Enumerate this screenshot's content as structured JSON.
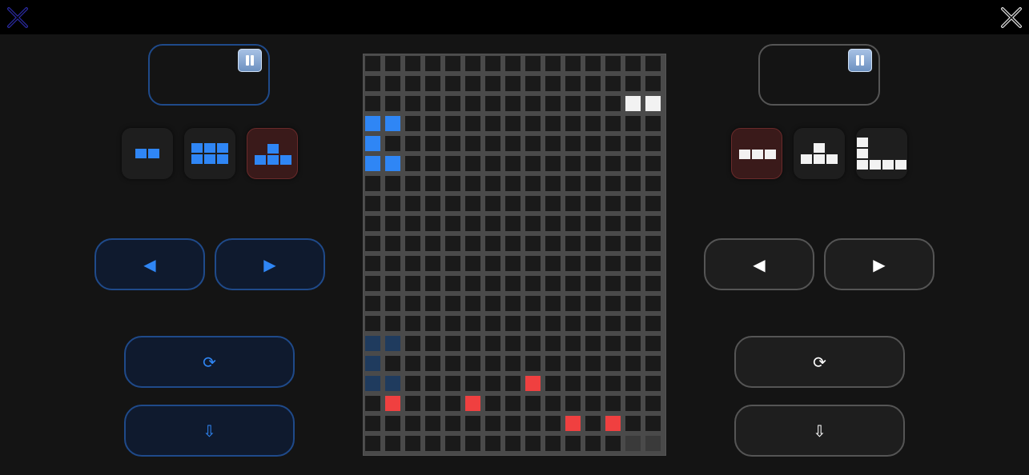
{
  "players": {
    "left": {
      "score": "",
      "color": "#2f86f5",
      "pieces": [
        {
          "name": "domino",
          "cells": [
            [
              0,
              0
            ],
            [
              1,
              0
            ]
          ],
          "selected": false
        },
        {
          "name": "rect-3x2",
          "cells": [
            [
              0,
              0
            ],
            [
              1,
              0
            ],
            [
              2,
              0
            ],
            [
              0,
              1
            ],
            [
              1,
              1
            ],
            [
              2,
              1
            ]
          ],
          "selected": false
        },
        {
          "name": "t-piece",
          "cells": [
            [
              1,
              0
            ],
            [
              0,
              1
            ],
            [
              1,
              1
            ],
            [
              2,
              1
            ]
          ],
          "selected": true
        }
      ],
      "buttons": {
        "left": "◀",
        "right": "▶",
        "rotate": "⟳",
        "drop": "⇩"
      }
    },
    "right": {
      "score": "",
      "color": "#f2f2f2",
      "pieces": [
        {
          "name": "i3",
          "cells": [
            [
              0,
              0
            ],
            [
              1,
              0
            ],
            [
              2,
              0
            ]
          ],
          "selected": true
        },
        {
          "name": "t-piece",
          "cells": [
            [
              1,
              0
            ],
            [
              0,
              1
            ],
            [
              1,
              1
            ],
            [
              2,
              1
            ]
          ],
          "selected": false
        },
        {
          "name": "l-piece",
          "cells": [
            [
              0,
              0
            ],
            [
              0,
              1
            ],
            [
              0,
              2
            ],
            [
              1,
              2
            ],
            [
              2,
              2
            ],
            [
              3,
              2
            ]
          ],
          "selected": false
        }
      ],
      "buttons": {
        "left": "◀",
        "right": "▶",
        "rotate": "⟳",
        "drop": "⇩"
      }
    }
  },
  "board": {
    "cols": 15,
    "rows": 20,
    "empty_color": "#1a1a1a",
    "grid_color": "#4a4a4a",
    "filled": [
      {
        "c": 13,
        "r": 2,
        "color": "#f2f2f2"
      },
      {
        "c": 14,
        "r": 2,
        "color": "#f2f2f2"
      },
      {
        "c": 0,
        "r": 3,
        "color": "#2f86f5"
      },
      {
        "c": 1,
        "r": 3,
        "color": "#2f86f5"
      },
      {
        "c": 0,
        "r": 4,
        "color": "#2f86f5"
      },
      {
        "c": 0,
        "r": 5,
        "color": "#2f86f5"
      },
      {
        "c": 1,
        "r": 5,
        "color": "#2f86f5"
      },
      {
        "c": 0,
        "r": 14,
        "color": "#1f3b5e"
      },
      {
        "c": 1,
        "r": 14,
        "color": "#1f3b5e"
      },
      {
        "c": 0,
        "r": 15,
        "color": "#1f3b5e"
      },
      {
        "c": 0,
        "r": 16,
        "color": "#1f3b5e"
      },
      {
        "c": 1,
        "r": 16,
        "color": "#1f3b5e"
      },
      {
        "c": 8,
        "r": 16,
        "color": "#f04040"
      },
      {
        "c": 1,
        "r": 17,
        "color": "#f04040"
      },
      {
        "c": 5,
        "r": 17,
        "color": "#f04040"
      },
      {
        "c": 10,
        "r": 18,
        "color": "#f04040"
      },
      {
        "c": 12,
        "r": 18,
        "color": "#f04040"
      },
      {
        "c": 13,
        "r": 19,
        "color": "#3a3a3a"
      },
      {
        "c": 14,
        "r": 19,
        "color": "#3a3a3a"
      }
    ]
  }
}
